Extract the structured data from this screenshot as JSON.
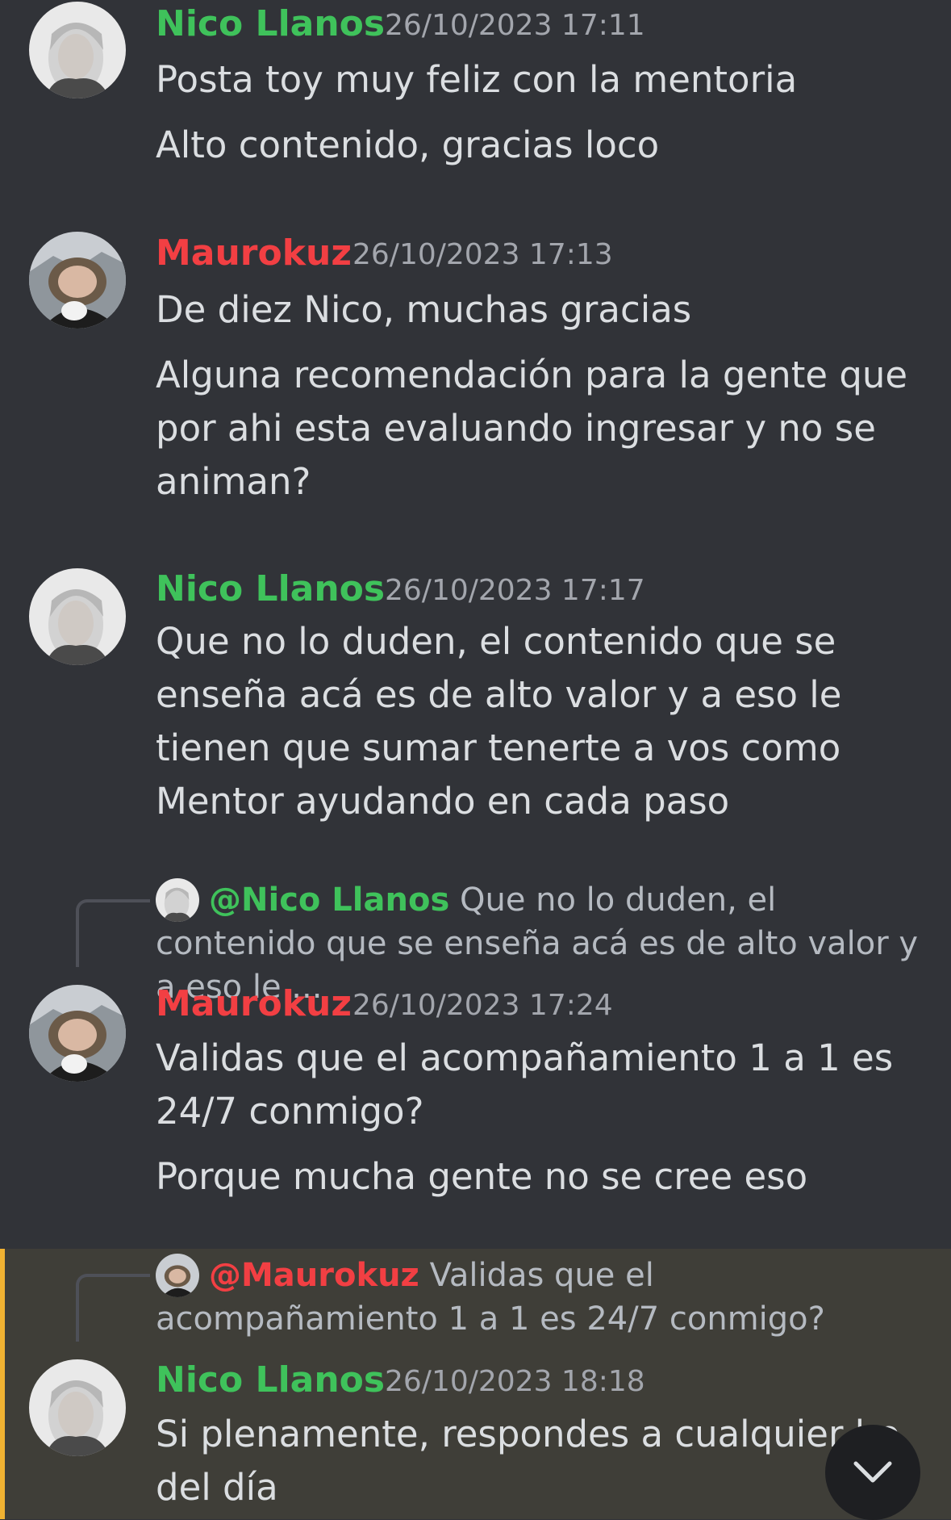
{
  "colors": {
    "nico": "#3fc25b",
    "mauro": "#f23f43",
    "highlight_bar": "#f0b232"
  },
  "messages": [
    {
      "author": "Nico Llanos",
      "timestamp": "26/10/2023 17:11",
      "lines": [
        "Posta toy muy feliz con la mentoria",
        "Alto contenido, gracias loco"
      ]
    },
    {
      "author": "Maurokuz",
      "timestamp": "26/10/2023 17:13",
      "lines": [
        "De diez Nico, muchas gracias",
        "Alguna recomendación para la gente que por ahi esta evaluando ingresar y no se animan?"
      ]
    },
    {
      "author": "Nico Llanos",
      "timestamp": "26/10/2023 17:17",
      "lines": [
        "Que no lo duden, el contenido que se enseña acá es de alto valor y a eso le tienen que sumar tenerte a vos como Mentor ayudando en cada paso"
      ]
    },
    {
      "reply": {
        "mention": "@Nico Llanos",
        "text": "Que no lo duden, el contenido que se enseña acá es de alto valor y a eso le ..."
      },
      "author": "Maurokuz",
      "timestamp": "26/10/2023 17:24",
      "lines": [
        "Validas que el acompañamiento 1 a 1 es 24/7 conmigo?",
        "Porque mucha gente no se cree eso"
      ]
    },
    {
      "reply": {
        "mention": "@Maurokuz",
        "text": "Validas que el acompañamiento 1 a 1 es 24/7 conmigo?"
      },
      "author": "Nico Llanos",
      "timestamp": "26/10/2023 18:18",
      "lines": [
        "Si plenamente, respondes a cualquier ho",
        "del día"
      ]
    }
  ],
  "scroll_button": {
    "icon": "chevron-down-icon"
  }
}
